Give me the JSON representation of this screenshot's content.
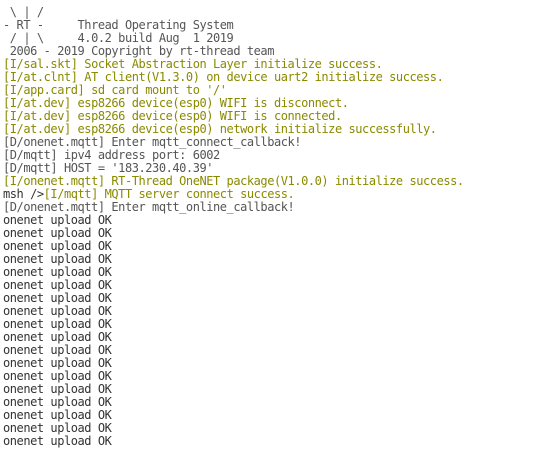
{
  "colors": {
    "background": "#ffffff",
    "default_text": "#333333",
    "info_text": "#8a8a00",
    "debug_text": "#555555"
  },
  "terminal": {
    "lines": [
      {
        "segments": [
          {
            "text": " \\ | /",
            "color": "#555555"
          }
        ]
      },
      {
        "segments": [
          {
            "text": "- RT -     Thread Operating System",
            "color": "#555555"
          }
        ]
      },
      {
        "segments": [
          {
            "text": " / | \\     4.0.2 build Aug  1 2019",
            "color": "#555555"
          }
        ]
      },
      {
        "segments": [
          {
            "text": " 2006 - 2019 Copyright by rt-thread team",
            "color": "#555555"
          }
        ]
      },
      {
        "segments": [
          {
            "text": "[I/sal.skt] Socket Abstraction Layer initialize success.",
            "color": "#8a8a00"
          }
        ]
      },
      {
        "segments": [
          {
            "text": "[I/at.clnt] AT client(V1.3.0) on device uart2 initialize success.",
            "color": "#8a8a00"
          }
        ]
      },
      {
        "segments": [
          {
            "text": "[I/app.card] sd card mount to '/'",
            "color": "#8a8a00"
          }
        ]
      },
      {
        "segments": [
          {
            "text": "[I/at.dev] esp8266 device(esp0) WIFI is disconnect.",
            "color": "#8a8a00"
          }
        ]
      },
      {
        "segments": [
          {
            "text": "[I/at.dev] esp8266 device(esp0) WIFI is connected.",
            "color": "#8a8a00"
          }
        ]
      },
      {
        "segments": [
          {
            "text": "[I/at.dev] esp8266 device(esp0) network initialize successfully.",
            "color": "#8a8a00"
          }
        ]
      },
      {
        "segments": [
          {
            "text": "[D/onenet.mqtt] Enter mqtt_connect_callback!",
            "color": "#555555"
          }
        ]
      },
      {
        "segments": [
          {
            "text": "[D/mqtt] ipv4 address port: 6002",
            "color": "#555555"
          }
        ]
      },
      {
        "segments": [
          {
            "text": "[D/mqtt] HOST = '183.230.40.39'",
            "color": "#555555"
          }
        ]
      },
      {
        "segments": [
          {
            "text": "[I/onenet.mqtt] RT-Thread OneNET package(V1.0.0) initialize success.",
            "color": "#8a8a00"
          }
        ]
      },
      {
        "segments": [
          {
            "text": "msh />",
            "color": "#333333"
          },
          {
            "text": "[I/mqtt] MQTT server connect success.",
            "color": "#8a8a00"
          }
        ]
      },
      {
        "segments": [
          {
            "text": "[D/onenet.mqtt] Enter mqtt_online_callback!",
            "color": "#555555"
          }
        ]
      },
      {
        "segments": [
          {
            "text": "onenet upload OK",
            "color": "#333333"
          }
        ]
      },
      {
        "segments": [
          {
            "text": "onenet upload OK",
            "color": "#333333"
          }
        ]
      },
      {
        "segments": [
          {
            "text": "onenet upload OK",
            "color": "#333333"
          }
        ]
      },
      {
        "segments": [
          {
            "text": "onenet upload OK",
            "color": "#333333"
          }
        ]
      },
      {
        "segments": [
          {
            "text": "onenet upload OK",
            "color": "#333333"
          }
        ]
      },
      {
        "segments": [
          {
            "text": "onenet upload OK",
            "color": "#333333"
          }
        ]
      },
      {
        "segments": [
          {
            "text": "onenet upload OK",
            "color": "#333333"
          }
        ]
      },
      {
        "segments": [
          {
            "text": "onenet upload OK",
            "color": "#333333"
          }
        ]
      },
      {
        "segments": [
          {
            "text": "onenet upload OK",
            "color": "#333333"
          }
        ]
      },
      {
        "segments": [
          {
            "text": "onenet upload OK",
            "color": "#333333"
          }
        ]
      },
      {
        "segments": [
          {
            "text": "onenet upload OK",
            "color": "#333333"
          }
        ]
      },
      {
        "segments": [
          {
            "text": "onenet upload OK",
            "color": "#333333"
          }
        ]
      },
      {
        "segments": [
          {
            "text": "onenet upload OK",
            "color": "#333333"
          }
        ]
      },
      {
        "segments": [
          {
            "text": "onenet upload OK",
            "color": "#333333"
          }
        ]
      },
      {
        "segments": [
          {
            "text": "onenet upload OK",
            "color": "#333333"
          }
        ]
      },
      {
        "segments": [
          {
            "text": "onenet upload OK",
            "color": "#333333"
          }
        ]
      },
      {
        "segments": [
          {
            "text": "onenet upload OK",
            "color": "#333333"
          }
        ]
      },
      {
        "segments": [
          {
            "text": "onenet upload OK",
            "color": "#333333"
          }
        ]
      }
    ]
  }
}
